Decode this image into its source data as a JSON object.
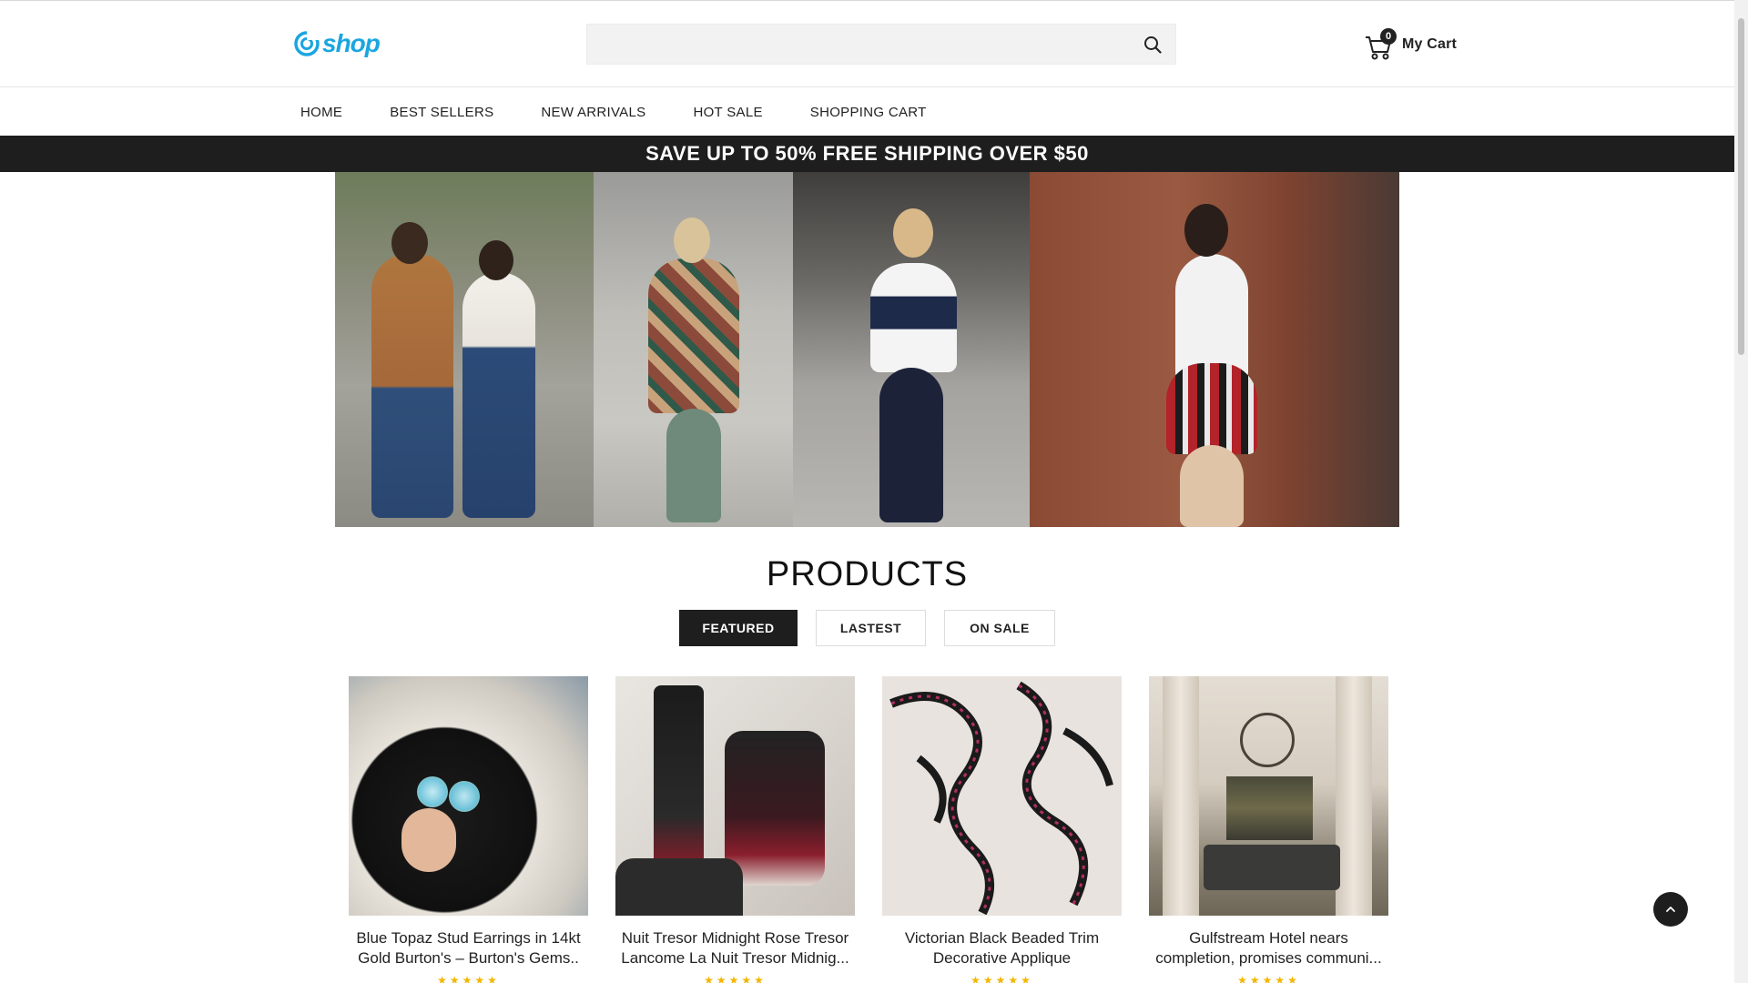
{
  "brand": {
    "logo_text": "shop",
    "accent": "#1aa6e0"
  },
  "search": {
    "placeholder": "",
    "icon": "search-icon"
  },
  "cart": {
    "count": "0",
    "label": "My Cart",
    "icon": "cart-icon"
  },
  "nav": {
    "items": [
      {
        "label": "HOME"
      },
      {
        "label": "BEST SELLERS"
      },
      {
        "label": "NEW ARRIVALS"
      },
      {
        "label": "HOT SALE"
      },
      {
        "label": "SHOPPING CART"
      }
    ]
  },
  "promo": {
    "text": "SAVE UP TO 50% FREE SHIPPING OVER $50",
    "bg": "#1e1e1e"
  },
  "products": {
    "title": "PRODUCTS",
    "tabs": [
      {
        "label": "FEATURED",
        "active": true
      },
      {
        "label": "LASTEST",
        "active": false
      },
      {
        "label": "ON SALE",
        "active": false
      }
    ],
    "items": [
      {
        "title": "Blue Topaz Stud Earrings in 14kt Gold Burton's – Burton's Gems..",
        "rating": "★★★★★"
      },
      {
        "title": "Nuit Tresor Midnight Rose Tresor Lancome La Nuit Tresor Midnig...",
        "rating": "★★★★★"
      },
      {
        "title": "Victorian Black Beaded Trim Decorative Applique",
        "rating": "★★★★★"
      },
      {
        "title": "Gulfstream Hotel nears completion, promises communi...",
        "rating": "★★★★★"
      }
    ]
  },
  "back_to_top": {
    "icon": "chevron-up-icon"
  }
}
